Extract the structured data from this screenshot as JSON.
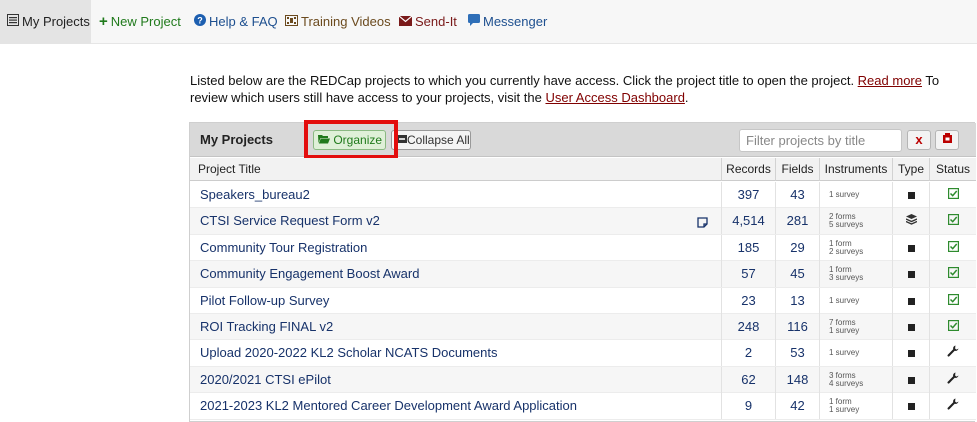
{
  "nav": {
    "items": [
      {
        "label": "My Projects",
        "icon": "list-icon"
      },
      {
        "label": "New Project",
        "icon": "plus-icon"
      },
      {
        "label": "Help & FAQ",
        "icon": "question-circle-icon"
      },
      {
        "label": "Training Videos",
        "icon": "film-icon"
      },
      {
        "label": "Send-It",
        "icon": "envelope-icon"
      },
      {
        "label": "Messenger",
        "icon": "chat-icon"
      }
    ]
  },
  "intro": {
    "text1": "Listed below are the REDCap projects to which you currently have access. Click the project title to open the project. ",
    "read_more": "Read more",
    "text2": " To review which users still have access to your projects, visit the ",
    "dashboard_link": "User Access Dashboard",
    "text3": "."
  },
  "panel": {
    "title": "My Projects",
    "organize_label": "Organize",
    "collapse_label": "Collapse All",
    "filter_placeholder": "Filter projects by title",
    "clear_label": "x"
  },
  "table": {
    "headers": {
      "title": "Project Title",
      "records": "Records",
      "fields": "Fields",
      "instruments": "Instruments",
      "type": "Type",
      "status": "Status"
    },
    "rows": [
      {
        "title": "Speakers_bureau2",
        "records": "397",
        "fields": "43",
        "instr1": "1 survey",
        "instr2": "",
        "type": "square",
        "status": "check",
        "note": false
      },
      {
        "title": "CTSI Service Request Form v2",
        "records": "4,514",
        "fields": "281",
        "instr1": "2 forms",
        "instr2": "5 surveys",
        "type": "layers",
        "status": "check",
        "note": true
      },
      {
        "title": "Community Tour Registration",
        "records": "185",
        "fields": "29",
        "instr1": "1 form",
        "instr2": "2 surveys",
        "type": "square",
        "status": "check",
        "note": false
      },
      {
        "title": "Community Engagement Boost Award",
        "records": "57",
        "fields": "45",
        "instr1": "1 form",
        "instr2": "3 surveys",
        "type": "square",
        "status": "check",
        "note": false
      },
      {
        "title": "Pilot Follow-up Survey",
        "records": "23",
        "fields": "13",
        "instr1": "1 survey",
        "instr2": "",
        "type": "square",
        "status": "check",
        "note": false
      },
      {
        "title": "ROI Tracking FINAL v2",
        "records": "248",
        "fields": "116",
        "instr1": "7 forms",
        "instr2": "1 survey",
        "type": "square",
        "status": "check",
        "note": false
      },
      {
        "title": "Upload 2020-2022 KL2 Scholar NCATS Documents",
        "records": "2",
        "fields": "53",
        "instr1": "1 survey",
        "instr2": "",
        "type": "square",
        "status": "wrench",
        "note": false
      },
      {
        "title": "2020/2021 CTSI ePilot",
        "records": "62",
        "fields": "148",
        "instr1": "3 forms",
        "instr2": "4 surveys",
        "type": "square",
        "status": "wrench",
        "note": false
      },
      {
        "title": "2021-2023 KL2 Mentored Career Development Award Application",
        "records": "9",
        "fields": "42",
        "instr1": "1 form",
        "instr2": "1 survey",
        "type": "square",
        "status": "wrench",
        "note": false
      }
    ]
  }
}
